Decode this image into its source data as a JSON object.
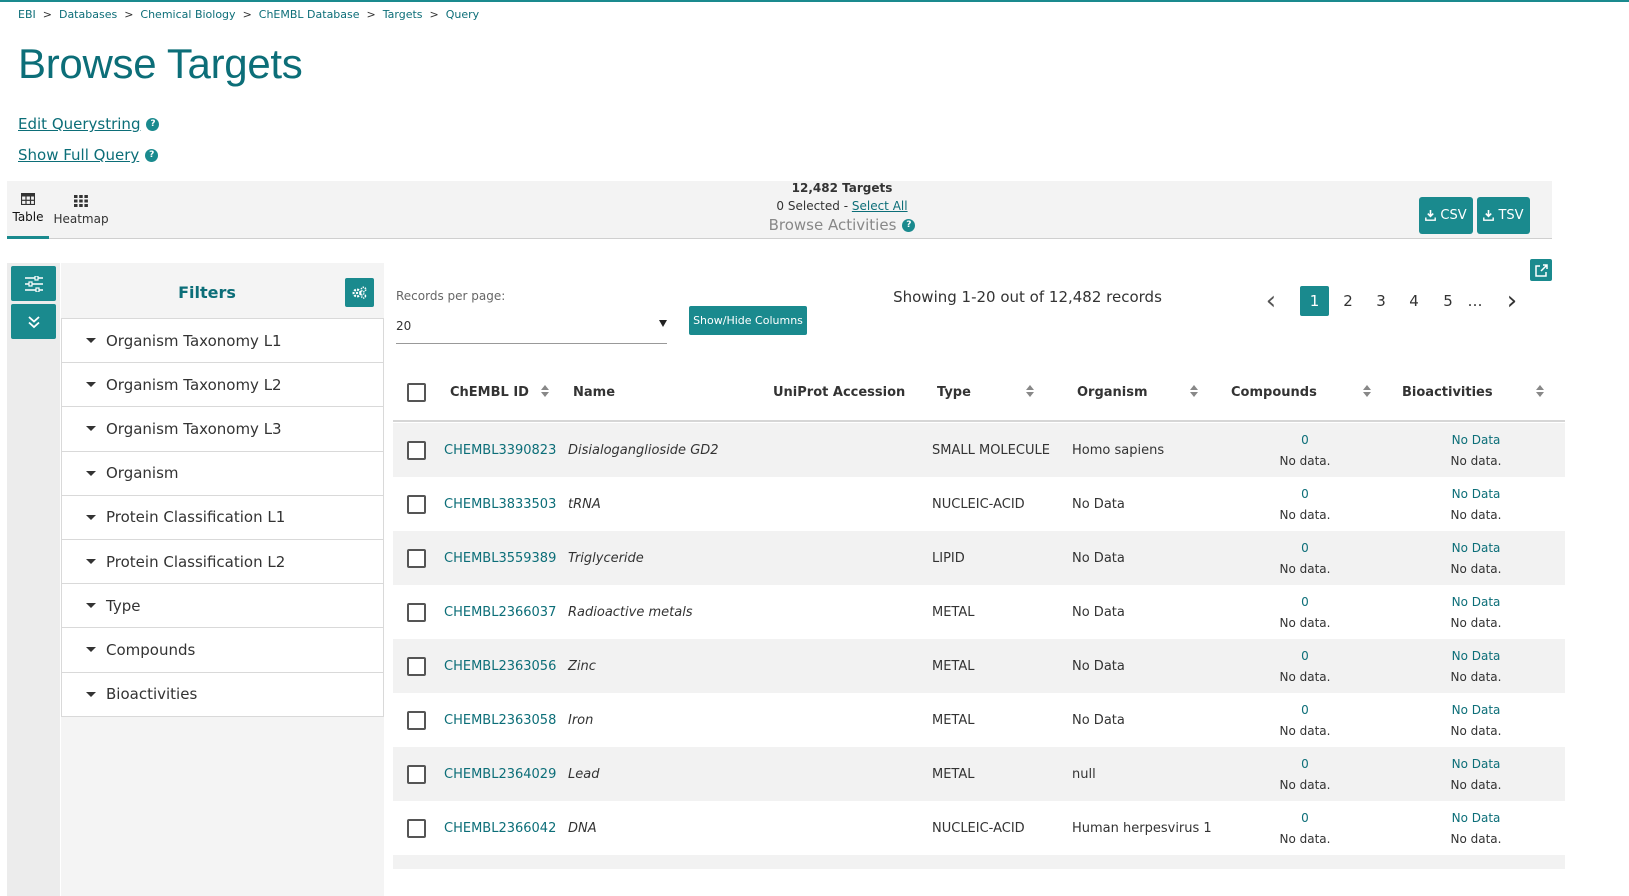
{
  "breadcrumb": [
    "EBI",
    "Databases",
    "Chemical Biology",
    "ChEMBL Database",
    "Targets",
    "Query"
  ],
  "breadcrumb_sep": ">",
  "title": "Browse Targets",
  "links": {
    "edit_querystring": "Edit Querystring",
    "show_full_query": "Show Full Query"
  },
  "help_glyph": "?",
  "view_tabs": {
    "table": "Table",
    "heatmap": "Heatmap",
    "active": "table"
  },
  "summary": {
    "count": "12,482 Targets",
    "selected": "0 Selected - ",
    "select_all": "Select All",
    "browse_activities": "Browse Activities"
  },
  "downloads": {
    "csv": "CSV",
    "tsv": "TSV"
  },
  "filters": {
    "title": "Filters",
    "items": [
      "Organism Taxonomy L1",
      "Organism Taxonomy L2",
      "Organism Taxonomy L3",
      "Organism",
      "Protein Classification L1",
      "Protein Classification L2",
      "Type",
      "Compounds",
      "Bioactivities"
    ]
  },
  "records_per_page": {
    "label": "Records per page:",
    "value": "20"
  },
  "show_hide_columns": "Show/Hide Columns",
  "showing": "Showing 1-20 out of 12,482 records",
  "pagination": {
    "pages": [
      "1",
      "2",
      "3",
      "4",
      "5"
    ],
    "ellipsis": "…",
    "active": "1",
    "prev": "‹",
    "next": "›"
  },
  "table": {
    "columns": [
      "ChEMBL ID",
      "Name",
      "UniProt Accession",
      "Type",
      "Organism",
      "Compounds",
      "Bioactivities"
    ],
    "rows": [
      {
        "id": "CHEMBL3390823",
        "name": "Disialoganglioside GD2",
        "uniprot": "",
        "type": "SMALL MOLECULE",
        "organism": "Homo sapiens",
        "compounds": "0",
        "compounds_sub": "No data.",
        "bioactivities": "No Data",
        "bioactivities_sub": "No data."
      },
      {
        "id": "CHEMBL3833503",
        "name": "tRNA",
        "uniprot": "",
        "type": "NUCLEIC-ACID",
        "organism": "No Data",
        "compounds": "0",
        "compounds_sub": "No data.",
        "bioactivities": "No Data",
        "bioactivities_sub": "No data."
      },
      {
        "id": "CHEMBL3559389",
        "name": "Triglyceride",
        "uniprot": "",
        "type": "LIPID",
        "organism": "No Data",
        "compounds": "0",
        "compounds_sub": "No data.",
        "bioactivities": "No Data",
        "bioactivities_sub": "No data."
      },
      {
        "id": "CHEMBL2366037",
        "name": "Radioactive metals",
        "uniprot": "",
        "type": "METAL",
        "organism": "No Data",
        "compounds": "0",
        "compounds_sub": "No data.",
        "bioactivities": "No Data",
        "bioactivities_sub": "No data."
      },
      {
        "id": "CHEMBL2363056",
        "name": "Zinc",
        "uniprot": "",
        "type": "METAL",
        "organism": "No Data",
        "compounds": "0",
        "compounds_sub": "No data.",
        "bioactivities": "No Data",
        "bioactivities_sub": "No data."
      },
      {
        "id": "CHEMBL2363058",
        "name": "Iron",
        "uniprot": "",
        "type": "METAL",
        "organism": "No Data",
        "compounds": "0",
        "compounds_sub": "No data.",
        "bioactivities": "No Data",
        "bioactivities_sub": "No data."
      },
      {
        "id": "CHEMBL2364029",
        "name": "Lead",
        "uniprot": "",
        "type": "METAL",
        "organism": "null",
        "compounds": "0",
        "compounds_sub": "No data.",
        "bioactivities": "No Data",
        "bioactivities_sub": "No data."
      },
      {
        "id": "CHEMBL2366042",
        "name": "DNA",
        "uniprot": "",
        "type": "NUCLEIC-ACID",
        "organism": "Human herpesvirus 1",
        "compounds": "0",
        "compounds_sub": "No data.",
        "bioactivities": "No Data",
        "bioactivities_sub": "No data."
      }
    ]
  },
  "colors": {
    "accent": "#1a8a8e",
    "link": "#0c6e78",
    "row_stripe": "#f2f2f2"
  }
}
